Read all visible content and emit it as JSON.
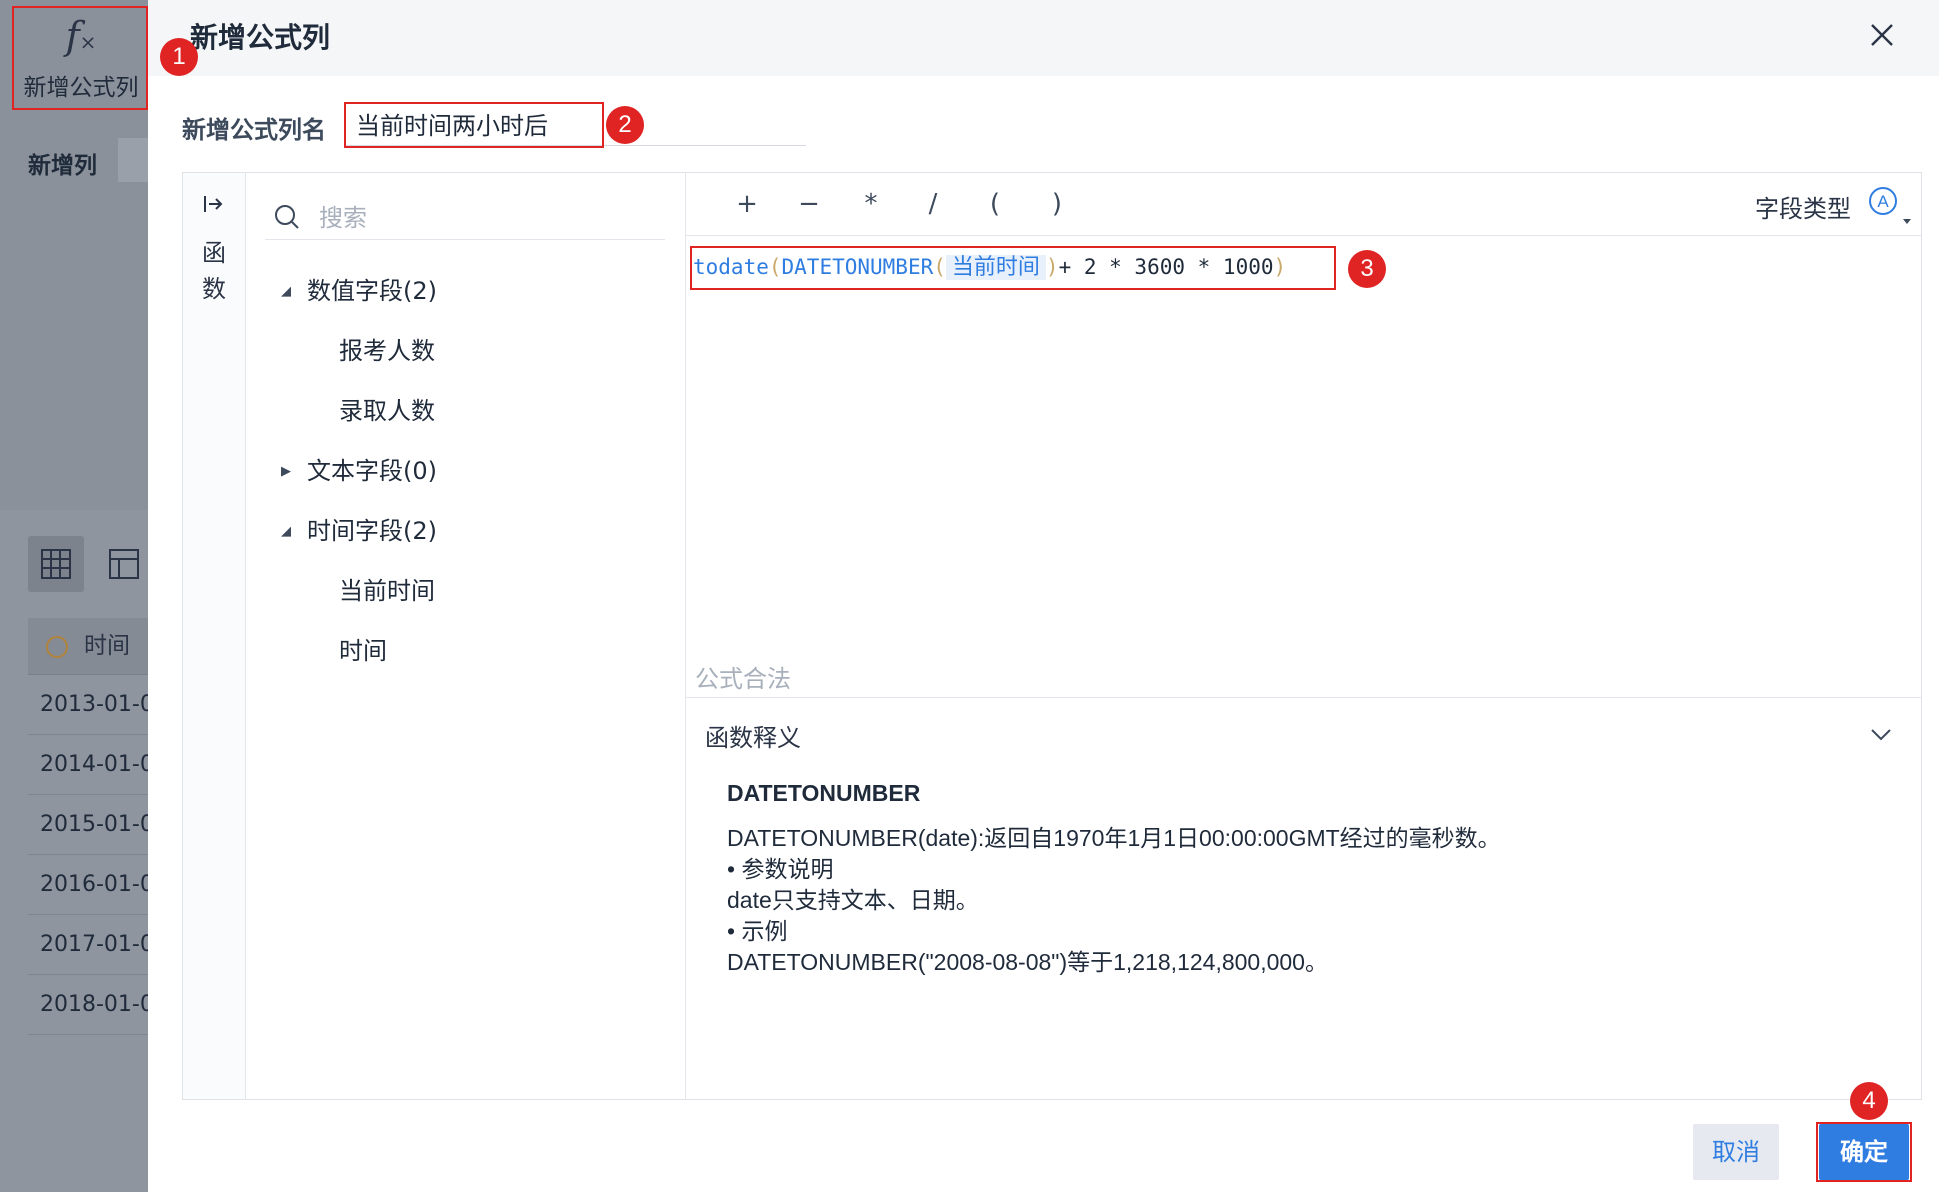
{
  "background": {
    "toolbar": {
      "add_formula_label": "新增公式列",
      "fx_icon": "fx-icon"
    },
    "new_column_label": "新增列",
    "table": {
      "header": "时间",
      "rows": [
        "2013-01-0",
        "2014-01-0",
        "2015-01-0",
        "2016-01-0",
        "2017-01-0",
        "2018-01-0"
      ]
    }
  },
  "dialog": {
    "title": "新增公式列",
    "name_label": "新增公式列名",
    "name_value": "当前时间两小时后",
    "function_rail_label": "函数",
    "search": {
      "placeholder": "搜索"
    },
    "tree": [
      {
        "label": "数值字段(2)",
        "expanded": true,
        "children": [
          "报考人数",
          "录取人数"
        ]
      },
      {
        "label": "文本字段(0)",
        "expanded": false,
        "children": []
      },
      {
        "label": "时间字段(2)",
        "expanded": true,
        "children": [
          "当前时间",
          "时间"
        ]
      }
    ],
    "operators": [
      "+",
      "−",
      "*",
      "/",
      "(",
      ")"
    ],
    "field_type_label": "字段类型",
    "field_type_icon": "A",
    "formula": {
      "fn_outer": "todate",
      "fn_inner": "DATETONUMBER",
      "field": "当前时间",
      "rest": "+ 2 * 3600 * 1000"
    },
    "formula_status": "公式合法",
    "explain": {
      "title": "函数释义",
      "fname": "DATETONUMBER",
      "lines": [
        "DATETONUMBER(date):返回自1970年1月1日00:00:00GMT经过的毫秒数。",
        "•  参数说明",
        "date只支持文本、日期。",
        "•  示例",
        "DATETONUMBER(\"2008-08-08\")等于1,218,124,800,000。"
      ]
    },
    "buttons": {
      "cancel": "取消",
      "ok": "确定"
    }
  },
  "annotations": {
    "badges": [
      "1",
      "2",
      "3",
      "4"
    ],
    "color": "#e02424"
  },
  "colors": {
    "accent": "#2f7de1",
    "annotation": "#e02424"
  }
}
